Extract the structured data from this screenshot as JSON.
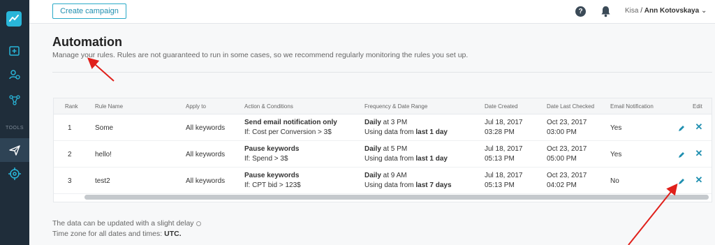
{
  "topbar": {
    "create_label": "Create campaign",
    "help_icon": "help-icon",
    "bell_icon": "bell-icon",
    "user_account": "Kisa",
    "user_separator": "/",
    "user_name": "Ann Kotovskaya",
    "user_caret": "⌄"
  },
  "sidebar": {
    "tools_label": "TOOLS",
    "icons": [
      "logo-icon",
      "campaign-add-icon",
      "users-settings-icon",
      "network-icon",
      "send-icon",
      "target-icon"
    ]
  },
  "page": {
    "title": "Automation",
    "description": "Manage your rules. Rules are not guaranteed to run in some cases, so we recommend regularly monitoring the rules you set up."
  },
  "table": {
    "headers": {
      "rank": "Rank",
      "rule_name": "Rule Name",
      "apply_to": "Apply to",
      "action": "Action & Conditions",
      "frequency": "Frequency & Date Range",
      "created": "Date Created",
      "checked": "Date Last Checked",
      "notify": "Email Notification",
      "edit": "Edit"
    },
    "rows": [
      {
        "rank": "1",
        "name": "Some",
        "apply_to": "All keywords",
        "action": "Send email notification only",
        "condition": "If: Cost per Conversion > 3$",
        "freq_day": "Daily",
        "freq_time": " at 3 PM",
        "range_prefix": "Using data from ",
        "range": "last 1 day",
        "created_date": "Jul 18, 2017",
        "created_time": "03:28 PM",
        "checked_date": "Oct 23, 2017",
        "checked_time": "03:00 PM",
        "notify": "Yes"
      },
      {
        "rank": "2",
        "name": "hello!",
        "apply_to": "All keywords",
        "action": "Pause keywords",
        "condition": "If: Spend > 3$",
        "freq_day": "Daily",
        "freq_time": " at 5 PM",
        "range_prefix": "Using data from ",
        "range": "last 1 day",
        "created_date": "Jul 18, 2017",
        "created_time": "05:13 PM",
        "checked_date": "Oct 23, 2017",
        "checked_time": "05:00 PM",
        "notify": "Yes"
      },
      {
        "rank": "3",
        "name": "test2",
        "apply_to": "All keywords",
        "action": "Pause keywords",
        "condition": "If: CPT bid > 123$",
        "freq_day": "Daily",
        "freq_time": " at 9 AM",
        "range_prefix": "Using data from ",
        "range": "last 7 days",
        "created_date": "Jul 18, 2017",
        "created_time": "05:13 PM",
        "checked_date": "Oct 23, 2017",
        "checked_time": "04:02 PM",
        "notify": "No"
      }
    ],
    "delete_glyph": "✕"
  },
  "footer": {
    "delay_note": "The data can be updated with a slight delay",
    "timezone_prefix": "Time zone for all dates and times: ",
    "timezone": "UTC."
  },
  "colors": {
    "accent": "#1f8fb0",
    "sidebar_bg": "#1f2d3a",
    "annotation_arrow": "#e0201b"
  }
}
